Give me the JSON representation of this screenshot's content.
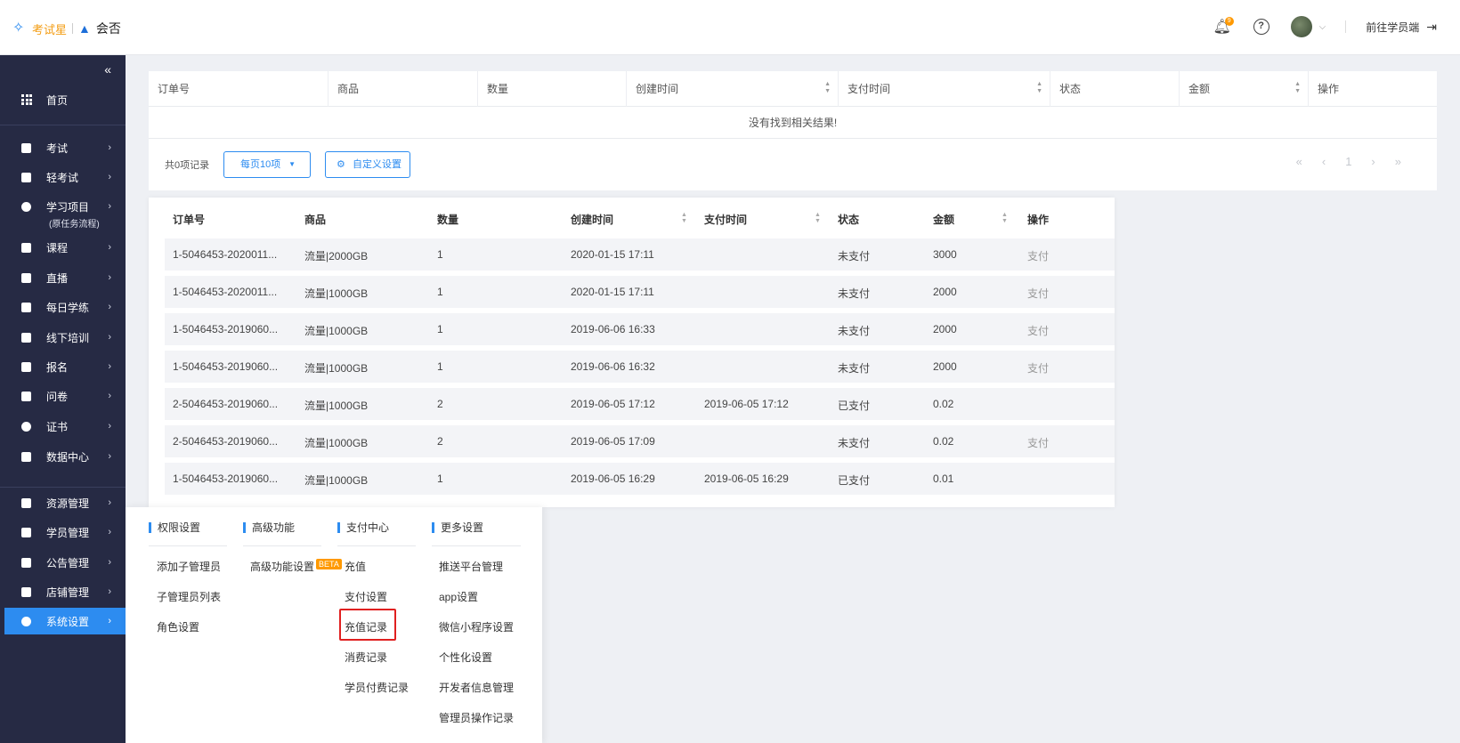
{
  "header": {
    "logo_text": "考试星",
    "logo_text2": "会否",
    "bell_badge": "9",
    "help_symbol": "?",
    "goto_label": "前往学员端",
    "icons": [
      "bell-icon",
      "help-icon",
      "avatar",
      "chevron-down-icon",
      "logout-icon"
    ]
  },
  "sidebar": {
    "collapse_symbol": "«",
    "home_label": "首页",
    "items": [
      {
        "label": "考试"
      },
      {
        "label": "轻考试"
      },
      {
        "label": "学习项目",
        "sub": "(原任务流程)"
      },
      {
        "label": "课程"
      },
      {
        "label": "直播"
      },
      {
        "label": "每日学练"
      },
      {
        "label": "线下培训"
      },
      {
        "label": "报名"
      },
      {
        "label": "问卷"
      },
      {
        "label": "证书"
      },
      {
        "label": "数据中心"
      },
      {
        "label": "资源管理"
      },
      {
        "label": "学员管理"
      },
      {
        "label": "公告管理"
      },
      {
        "label": "店铺管理"
      },
      {
        "label": "系统设置"
      }
    ],
    "arrow": "›"
  },
  "bg_table": {
    "columns": [
      "订单号",
      "商品",
      "数量",
      "创建时间",
      "支付时间",
      "状态",
      "金额",
      "操作"
    ],
    "empty_text": "没有找到相关结果!",
    "total": "共0项记录",
    "page_size": "每页10项",
    "custom_label": "自定义设置",
    "page_number": "1"
  },
  "fg_table": {
    "columns": [
      "订单号",
      "商品",
      "数量",
      "创建时间",
      "支付时间",
      "状态",
      "金额",
      "操作"
    ],
    "rows": [
      {
        "order": "1-5046453-2020011...",
        "product": "流量|2000GB",
        "qty": "1",
        "created": "2020-01-15 17:11",
        "paid": "",
        "status": "未支付",
        "amount": "3000",
        "action": "支付"
      },
      {
        "order": "1-5046453-2020011...",
        "product": "流量|1000GB",
        "qty": "1",
        "created": "2020-01-15 17:11",
        "paid": "",
        "status": "未支付",
        "amount": "2000",
        "action": "支付"
      },
      {
        "order": "1-5046453-2019060...",
        "product": "流量|1000GB",
        "qty": "1",
        "created": "2019-06-06 16:33",
        "paid": "",
        "status": "未支付",
        "amount": "2000",
        "action": "支付"
      },
      {
        "order": "1-5046453-2019060...",
        "product": "流量|1000GB",
        "qty": "1",
        "created": "2019-06-06 16:32",
        "paid": "",
        "status": "未支付",
        "amount": "2000",
        "action": "支付"
      },
      {
        "order": "2-5046453-2019060...",
        "product": "流量|1000GB",
        "qty": "2",
        "created": "2019-06-05 17:12",
        "paid": "2019-06-05 17:12",
        "status": "已支付",
        "amount": "0.02",
        "action": ""
      },
      {
        "order": "2-5046453-2019060...",
        "product": "流量|1000GB",
        "qty": "2",
        "created": "2019-06-05 17:09",
        "paid": "",
        "status": "未支付",
        "amount": "0.02",
        "action": "支付"
      },
      {
        "order": "1-5046453-2019060...",
        "product": "流量|1000GB",
        "qty": "1",
        "created": "2019-06-05 16:29",
        "paid": "2019-06-05 16:29",
        "status": "已支付",
        "amount": "0.01",
        "action": ""
      }
    ]
  },
  "menu": {
    "columns": [
      {
        "title": "权限设置",
        "items": [
          "添加子管理员",
          "子管理员列表",
          "角色设置"
        ]
      },
      {
        "title": "高级功能",
        "items": [
          "高级功能设置"
        ],
        "badge": "BETA"
      },
      {
        "title": "支付中心",
        "items": [
          "充值",
          "支付设置",
          "充值记录",
          "消费记录",
          "学员付费记录"
        ]
      },
      {
        "title": "更多设置",
        "items": [
          "推送平台管理",
          "app设置",
          "微信小程序设置",
          "个性化设置",
          "开发者信息管理",
          "管理员操作记录"
        ]
      }
    ]
  },
  "colors": {
    "accent": "#2d8cf0",
    "sidebar": "#262a44",
    "highlight": "#e02020",
    "badge": "#ff9900"
  }
}
